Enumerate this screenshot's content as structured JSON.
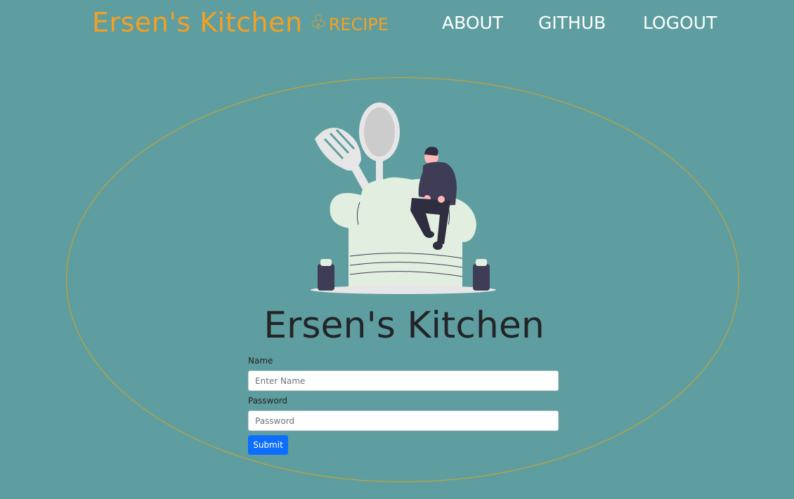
{
  "nav": {
    "brand_name": "Ersen's Kitchen",
    "brand_icon": "♧",
    "brand_sub": "RECIPE",
    "links": {
      "about": "ABOUT",
      "github": "GITHUB",
      "logout": "LOGOUT"
    }
  },
  "hero": {
    "title": "Ersen's Kitchen",
    "illustration": "chef-hat-cutlery-person-illustration"
  },
  "form": {
    "name_label": "Name",
    "name_placeholder": "Enter Name",
    "name_value": "",
    "password_label": "Password",
    "password_placeholder": "Password",
    "password_value": "",
    "submit_label": "Submit"
  },
  "colors": {
    "background": "#5f9ea0",
    "brand": "#f4a022",
    "ellipse_border": "#d9a223",
    "submit": "#0d6efd",
    "title": "#222427"
  }
}
